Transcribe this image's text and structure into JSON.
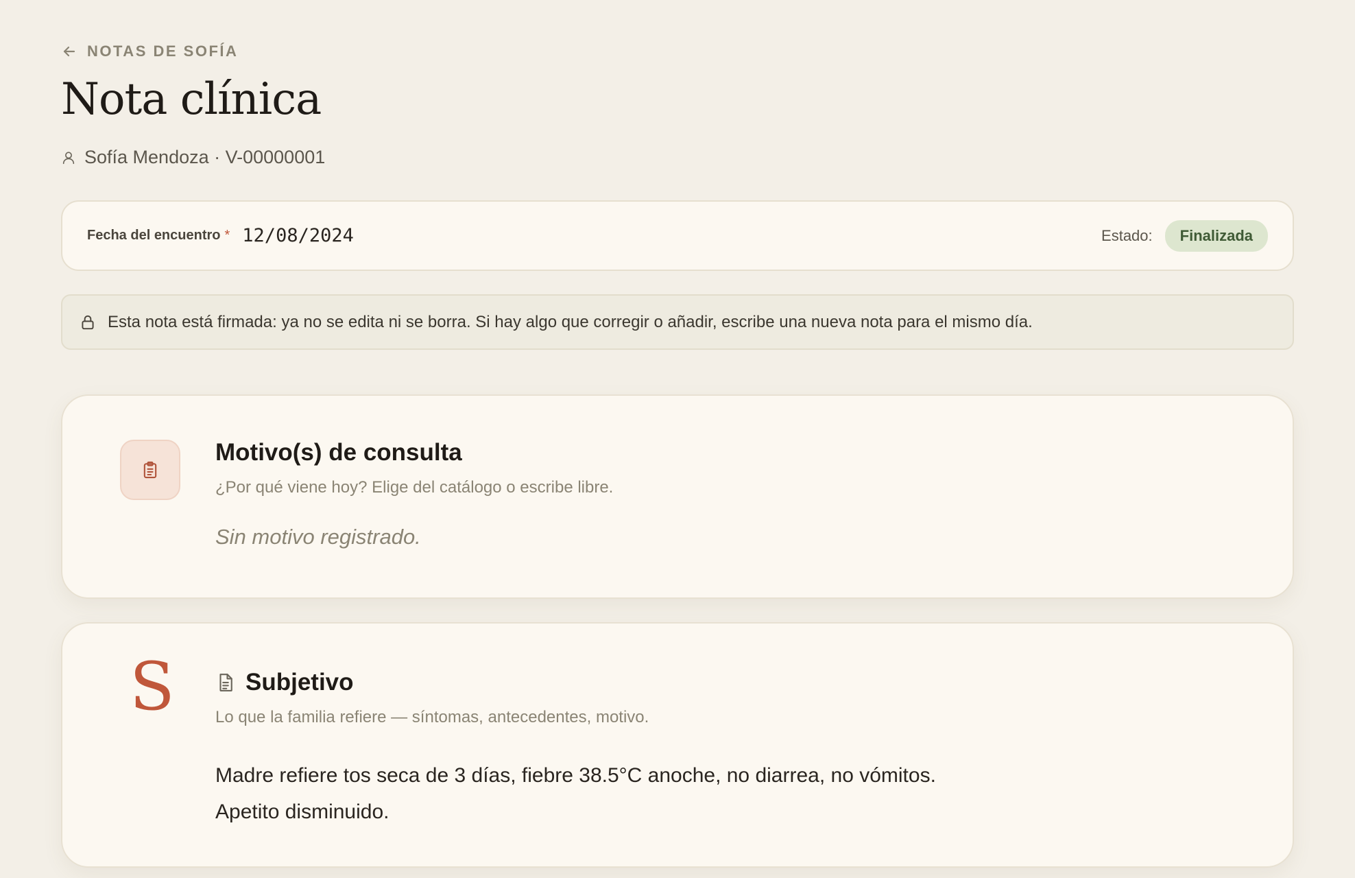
{
  "nav": {
    "back_label": "NOTAS DE SOFÍA"
  },
  "page": {
    "title": "Nota clínica"
  },
  "patient": {
    "line": "Sofía Mendoza · V-00000001"
  },
  "encounter": {
    "date_label": "Fecha del encuentro",
    "required_mark": "*",
    "date_value": "12/08/2024",
    "status_label": "Estado:",
    "status_value": "Finalizada"
  },
  "notice": {
    "text": "Esta nota está firmada: ya no se edita ni se borra. Si hay algo que corregir o añadir, escribe una nueva nota para el mismo día."
  },
  "motivo": {
    "title": "Motivo(s) de consulta",
    "subtitle": "¿Por qué viene hoy? Elige del catálogo o escribe libre.",
    "empty": "Sin motivo registrado."
  },
  "subjetivo": {
    "letter": "S",
    "title": "Subjetivo",
    "subtitle": "Lo que la familia refiere — síntomas, antecedentes, motivo.",
    "line1": "Madre refiere tos seca de 3 días, fiebre 38.5°C anoche, no diarrea, no vómitos.",
    "line2": "Apetito disminuido."
  },
  "colors": {
    "background": "#f3efe7",
    "card": "#fcf8f1",
    "accent": "#c0573a",
    "status_bg": "#dde6cf",
    "status_text": "#3f5a35"
  },
  "icons": {
    "back": "arrow-left-icon",
    "patient": "user-icon",
    "lock": "lock-icon",
    "motivo": "clipboard-list-icon",
    "subjetivo": "document-icon"
  }
}
